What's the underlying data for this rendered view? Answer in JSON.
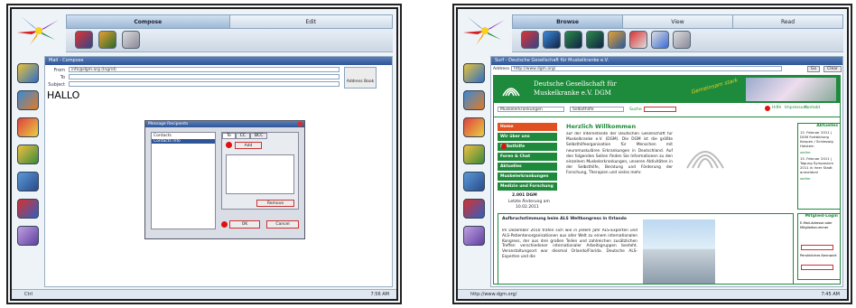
{
  "left": {
    "tabs": [
      "Compose",
      "Edit"
    ],
    "window_title": "Mail - Compose",
    "fields": [
      {
        "label": "From",
        "value": "info@dgm.org (Ingrid)"
      },
      {
        "label": "To",
        "value": ""
      },
      {
        "label": "Subject",
        "value": ""
      }
    ],
    "address_book": "Address Book",
    "body_text": "HALLO",
    "dialog": {
      "title": "Message Recipients",
      "list_header": "Contacts",
      "list_selected": "Contacts Info",
      "tabs": [
        "To",
        "CC",
        "BCC"
      ],
      "add": "Add",
      "remove": "Remove",
      "ok": "OK",
      "cancel": "Cancel"
    },
    "status_left": "Ctrl",
    "status_right": "7:56 AM"
  },
  "right": {
    "tabs": [
      "Browse",
      "View",
      "Read"
    ],
    "window_title": "Surf - Deutsche Gesellschaft für Muskelkranke e.V.",
    "address_label": "Address",
    "address": "http://www.dgm.org/",
    "go": "Go",
    "clear": "Clear",
    "site": {
      "name_line1": "Deutsche Gesellschaft für",
      "name_line2": "Muskelkranke e.V. DGM",
      "slogan": "Gemeinsam stark",
      "select1": "Muskelerkrankungen",
      "select2": "Selbsthilfe",
      "search": "Suche",
      "help": "Hilfe",
      "impressum": "Impressum",
      "kontakt": "Kontakt",
      "nav": [
        "Home",
        "Wir über uns",
        "Selbsthilfe",
        "Foren & Chat",
        "Aktuelles",
        "Muskelerkrankungen",
        "Medizin und Forschung"
      ],
      "counter": "2.001 DGM",
      "update_label": "Letzte Änderung am",
      "update_date": "10.02.2011",
      "welcome_title": "Herzlich Willkommen",
      "welcome_text": "auf der Internetseite der Deutschen Gesellschaft für Muskelkranke e.V. (DGM). Die DGM ist die größte Selbsthilfeorganisation für Menschen mit neuromuskulären Erkrankungen in Deutschland. Auf den folgenden Seiten finden Sie Informationen zu den einzelnen Muskelerkrankungen, unseren Aktivitäten in der Selbsthilfe, Beratung und Förderung der Forschung, Therapien und vieles mehr.",
      "news_title": "Aufbruchstimmung beim ALS Weltkongress in Orlando",
      "news_text": "Im Dezember 2010 trafen sich wie in jedem Jahr ALS-Experten und ALS-Patientenorganisationen aus aller Welt zu einem internationalen Kongress, der aus drei großen Teilen und zahlreichen zusätzlichen Treffen verschiedener internationaler Arbeitsgruppen besteht. Veranstaltungsort war diesmal Orlando/Florida. Deutsche ALS-Experten und die",
      "aktuelles": "Aktuelles",
      "news_items": [
        "12. Februar 2011 | DGM Fortbildung Kanpen / Schleswig Holstein",
        "weiter",
        "15. Februar 2011 | Tagung Symposium 2011 in ihrer Stadt anmelden!",
        "weiter"
      ],
      "mitglied": "Mitglied-Login",
      "email_label": "E-Mail-Adresse oder Mitgliedsnummer",
      "pw_label": "Persönliches Kennwort"
    },
    "status_url": "http://www.dgm.org/",
    "status_right": "7:45 AM"
  }
}
